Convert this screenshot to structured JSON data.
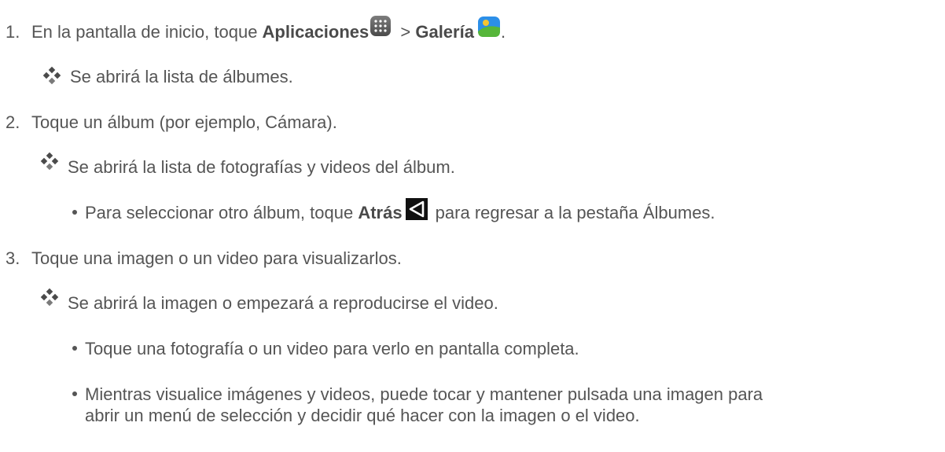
{
  "steps": [
    {
      "number": "1.",
      "text_prefix": "En la pantalla de inicio, toque ",
      "bold1": "Aplicaciones",
      "separator": " > ",
      "bold2": "Galería",
      "suffix": "."
    },
    {
      "number": "2.",
      "text": "Toque un álbum (por ejemplo, Cámara)."
    },
    {
      "number": "3.",
      "text": "Toque una imagen o un video para visualizarlos."
    }
  ],
  "results": {
    "r1": "Se abrirá la lista de álbumes.",
    "r2": "Se abrirá la lista de fotografías y videos del álbum.",
    "r3": "Se abrirá la imagen o empezará a reproducirse el video."
  },
  "bullets": {
    "b1_prefix": "Para seleccionar otro álbum, toque ",
    "b1_bold": "Atrás",
    "b1_suffix": " para regresar a la pestaña Álbumes.",
    "b2": "Toque una fotografía o un video para verlo en pantalla completa.",
    "b3_line1": "Mientras visualice imágenes y videos, puede tocar y mantener pulsada una imagen para",
    "b3_line2": "abrir un menú de selección y decidir qué hacer con la imagen o el video."
  },
  "icons": {
    "apps": "apps-grid-icon",
    "gallery": "gallery-icon",
    "back": "back-triangle-icon",
    "result_marker": "diamond-bullet-icon"
  }
}
